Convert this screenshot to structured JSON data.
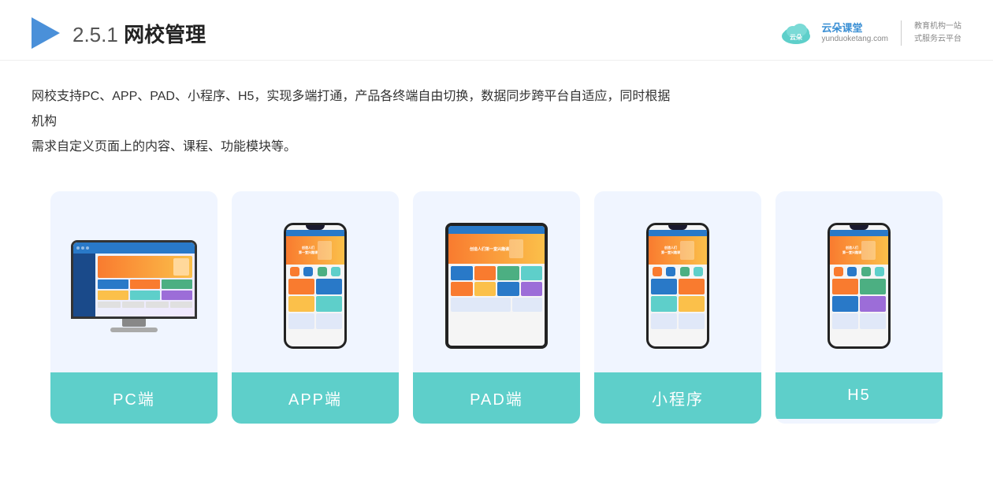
{
  "header": {
    "page_number": "2.5.1",
    "page_title": "网校管理",
    "brand": {
      "name": "云朵课堂",
      "website": "yunduoketang.com",
      "slogan_line1": "教育机构一站",
      "slogan_line2": "式服务云平台"
    }
  },
  "description": {
    "line1": "网校支持PC、APP、PAD、小程序、H5，实现多端打通，产品各终端自由切换，数据同步跨平台自适应，同时根据机构",
    "line2": "需求自定义页面上的内容、课程、功能模块等。"
  },
  "cards": [
    {
      "id": "pc",
      "label": "PC端"
    },
    {
      "id": "app",
      "label": "APP端"
    },
    {
      "id": "pad",
      "label": "PAD端"
    },
    {
      "id": "miniprogram",
      "label": "小程序"
    },
    {
      "id": "h5",
      "label": "H5"
    }
  ]
}
